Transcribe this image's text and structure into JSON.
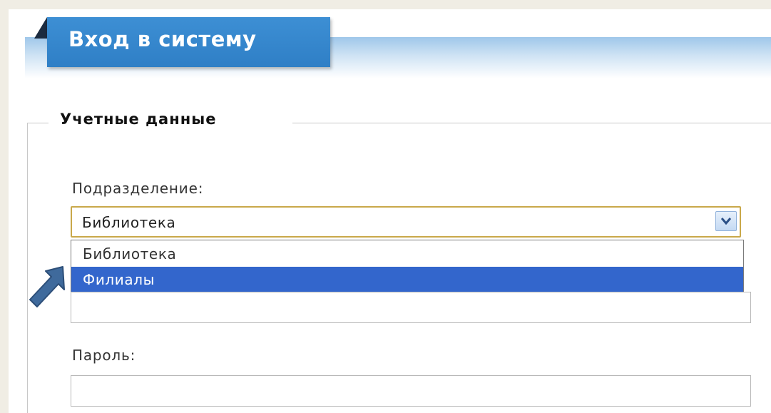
{
  "header": {
    "title": "Вход в систему"
  },
  "credentials": {
    "legend": "Учетные данные",
    "division": {
      "label": "Подразделение:",
      "selected_value": "Библиотека",
      "options": [
        "Библиотека",
        "Филиалы"
      ],
      "highlighted_option_index": 1
    },
    "login": {
      "value": ""
    },
    "password": {
      "label": "Пароль:",
      "value": ""
    }
  },
  "icons": {
    "select_arrow": "chevron-down-icon",
    "pointer": "pointer-arrow-icon"
  },
  "colors": {
    "header_tab": "#2f7fc6",
    "highlight": "#3366cc",
    "select_border": "#c9a84a",
    "pointer_arrow": "#3f6a9c"
  }
}
